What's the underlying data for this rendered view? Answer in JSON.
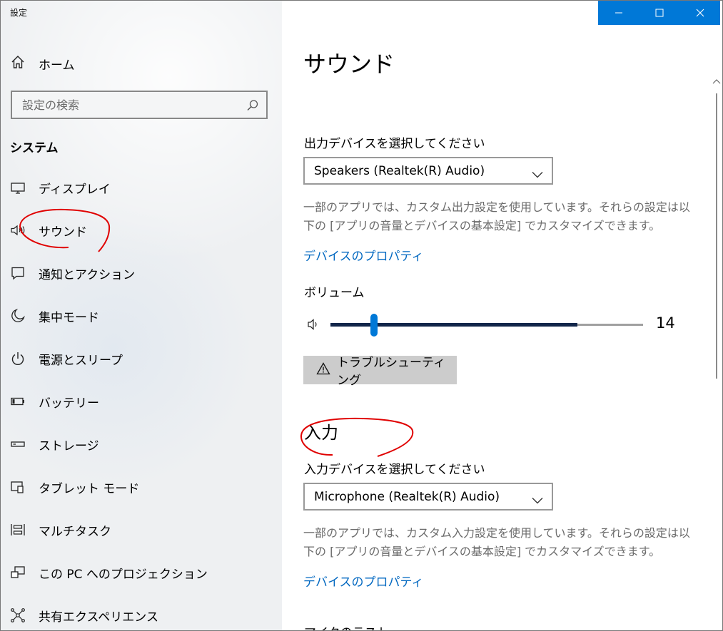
{
  "window": {
    "title": "設定",
    "accent_color": "#0078d7"
  },
  "sidebar": {
    "home_label": "ホーム",
    "search_placeholder": "設定の検索",
    "section_label": "システム",
    "items": [
      {
        "label": "ディスプレイ",
        "icon": "monitor-icon"
      },
      {
        "label": "サウンド",
        "icon": "speaker-icon"
      },
      {
        "label": "通知とアクション",
        "icon": "notification-icon"
      },
      {
        "label": "集中モード",
        "icon": "moon-icon"
      },
      {
        "label": "電源とスリープ",
        "icon": "power-icon"
      },
      {
        "label": "バッテリー",
        "icon": "battery-icon"
      },
      {
        "label": "ストレージ",
        "icon": "storage-icon"
      },
      {
        "label": "タブレット モード",
        "icon": "tablet-mode-icon"
      },
      {
        "label": "マルチタスク",
        "icon": "multitask-icon"
      },
      {
        "label": "この PC へのプロジェクション",
        "icon": "projection-icon"
      },
      {
        "label": "共有エクスペリエンス",
        "icon": "share-icon"
      }
    ]
  },
  "main": {
    "title": "サウンド",
    "output": {
      "label": "出力デバイスを選択してください",
      "device": "Speakers (Realtek(R) Audio)",
      "description": "一部のアプリでは、カスタム出力設定を使用しています。それらの設定は以下の [アプリの音量とデバイスの基本設定] でカスタマイズできます。",
      "link": "デバイスのプロパティ",
      "volume_label": "ボリューム",
      "volume": 14,
      "level_fraction": 0.79,
      "troubleshoot_label": "トラブルシューティング"
    },
    "input": {
      "section_title": "入力",
      "label": "入力デバイスを選択してください",
      "device": "Microphone (Realtek(R) Audio)",
      "description": "一部のアプリでは、カスタム入力設定を使用しています。それらの設定は以下の [アプリの音量とデバイスの基本設定] でカスタマイズできます。",
      "link": "デバイスのプロパティ",
      "next_label": "マイクのテスト"
    }
  }
}
